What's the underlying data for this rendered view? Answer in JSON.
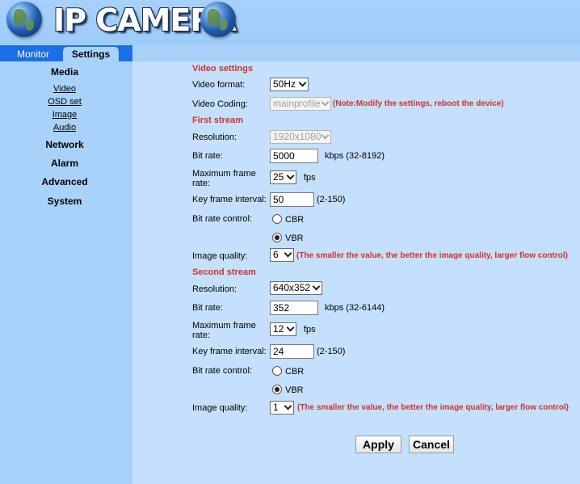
{
  "header": {
    "title": "IP CAMERA"
  },
  "tabs": {
    "monitor": "Monitor",
    "settings": "Settings"
  },
  "sidebar": {
    "media": "Media",
    "media_items": [
      "Video",
      "OSD set",
      "Image",
      "Audio"
    ],
    "network": "Network",
    "alarm": "Alarm",
    "advanced": "Advanced",
    "system": "System"
  },
  "video": {
    "section_title": "Video settings",
    "format_label": "Video format:",
    "format_value": "50Hz",
    "coding_label": "Video Coding:",
    "coding_value": "mainprofile",
    "coding_note": "(Note:Modify the settings, reboot the device)"
  },
  "first": {
    "section_title": "First stream",
    "resolution_label": "Resolution:",
    "resolution_value": "1920x1080",
    "bitrate_label": "Bit rate:",
    "bitrate_value": "5000",
    "bitrate_range": "kbps (32-8192)",
    "framerate_label": "Maximum frame rate:",
    "framerate_value": "25",
    "fps": "fps",
    "keyframe_label": "Key frame interval:",
    "keyframe_value": "50",
    "keyframe_range": "(2-150)",
    "control_label": "Bit rate control:",
    "cbr": "CBR",
    "vbr": "VBR",
    "quality_label": "Image quality:",
    "quality_value": "6",
    "quality_note": "(The smaller the value, the better the image quality, larger flow control)"
  },
  "second": {
    "section_title": "Second stream",
    "resolution_label": "Resolution:",
    "resolution_value": "640x352",
    "bitrate_label": "Bit rate:",
    "bitrate_value": "352",
    "bitrate_range": "kbps (32-6144)",
    "framerate_label": "Maximum frame rate:",
    "framerate_value": "12",
    "fps": "fps",
    "keyframe_label": "Key frame interval:",
    "keyframe_value": "24",
    "keyframe_range": "(2-150)",
    "control_label": "Bit rate control:",
    "cbr": "CBR",
    "vbr": "VBR",
    "quality_label": "Image quality:",
    "quality_value": "1",
    "quality_note": "(The smaller the value, the better the image quality, larger flow control)"
  },
  "buttons": {
    "apply": "Apply",
    "cancel": "Cancel"
  }
}
